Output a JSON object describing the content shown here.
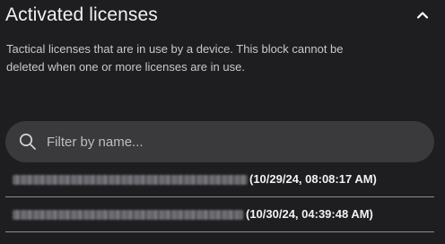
{
  "section": {
    "title": "Activated licenses",
    "description": "Tactical licenses that are in use by a device. This block cannot be deleted when one or more licenses are in use."
  },
  "search": {
    "placeholder": "Filter by name..."
  },
  "licenses": [
    {
      "name_redacted": true,
      "timestamp": "(10/29/24, 08:08:17 AM)"
    },
    {
      "name_redacted": true,
      "timestamp": "(10/30/24, 04:39:48 AM)"
    }
  ],
  "colors": {
    "background": "#1e1e20",
    "search_background": "#3a3a3c",
    "divider": "#8d8d8f"
  },
  "icons": {
    "collapse": "chevron-up-icon",
    "search": "search-icon"
  }
}
